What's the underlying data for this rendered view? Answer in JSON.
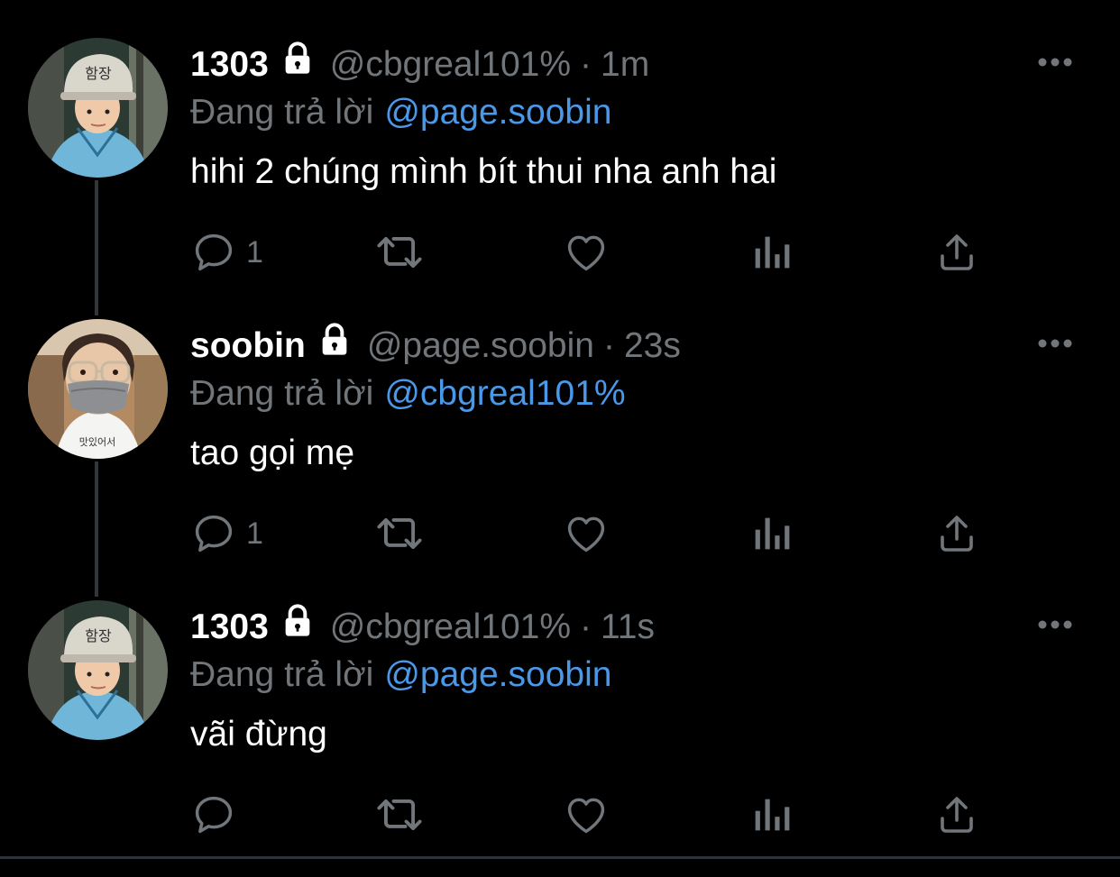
{
  "colors": {
    "background": "#000000",
    "text_primary": "#ffffff",
    "text_secondary": "#71767b",
    "link": "#4a99e9",
    "thread_line": "#333639"
  },
  "reply_prefix": "Đang trả lời",
  "tweets": [
    {
      "display_name": "1303",
      "handle": "@cbgreal101%",
      "separator": "·",
      "time": "1m",
      "replying_to": "@page.soobin",
      "text": "hihi 2 chúng mình bít thui nha anh hai",
      "reply_count": "1",
      "avatar": "avatar-child-helmet"
    },
    {
      "display_name": "soobin",
      "handle": "@page.soobin",
      "separator": "·",
      "time": "23s",
      "replying_to": "@cbgreal101%",
      "text": "tao gọi mẹ",
      "reply_count": "1",
      "avatar": "avatar-masked-person"
    },
    {
      "display_name": "1303",
      "handle": "@cbgreal101%",
      "separator": "·",
      "time": "11s",
      "replying_to": "@page.soobin",
      "text": "vãi đừng",
      "reply_count": "",
      "avatar": "avatar-child-helmet"
    }
  ],
  "icons": {
    "reply": "reply-icon",
    "retweet": "retweet-icon",
    "like": "heart-icon",
    "views": "analytics-icon",
    "share": "share-icon",
    "more": "more-icon",
    "lock": "lock-icon"
  }
}
